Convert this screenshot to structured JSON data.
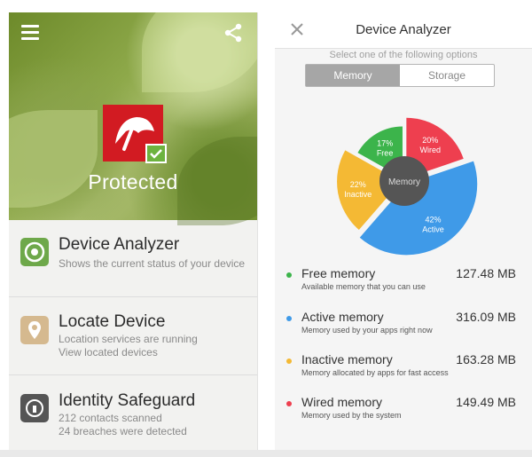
{
  "left": {
    "status": "Protected",
    "items": [
      {
        "title": "Device Analyzer",
        "lines": [
          "Shows the current status of your device"
        ]
      },
      {
        "title": "Locate Device",
        "lines": [
          "Location services are running",
          "View located devices"
        ]
      },
      {
        "title": "Identity Safeguard",
        "lines": [
          "212 contacts scanned",
          "24 breaches were detected"
        ]
      }
    ]
  },
  "icons": {
    "menu": "hamburger-menu-icon",
    "share": "share-icon",
    "logo": "avira-umbrella-logo",
    "check": "checkmark-icon",
    "analyzer": "device-analyzer-icon",
    "locate": "map-pin-icon",
    "identity": "lock-icon",
    "close": "close-icon"
  },
  "colors": {
    "brand_red": "#d21b22",
    "check_green": "#6db33f",
    "free": "#3cb44b",
    "active": "#3f9ae8",
    "inactive": "#f4b934",
    "wired": "#ee3f4f",
    "center": "#555555"
  },
  "right": {
    "title": "Device Analyzer",
    "hint": "Select one of the following options",
    "tabs": [
      {
        "label": "Memory",
        "active": true
      },
      {
        "label": "Storage",
        "active": false
      }
    ],
    "legend": [
      {
        "name": "Free memory",
        "desc": "Available memory that you can use",
        "value": "127.48 MB"
      },
      {
        "name": "Active memory",
        "desc": "Memory used by your apps right now",
        "value": "316.09 MB"
      },
      {
        "name": "Inactive memory",
        "desc": "Memory allocated by apps for fast access",
        "value": "163.28 MB"
      },
      {
        "name": "Wired memory",
        "desc": "Memory used by the system",
        "value": "149.49 MB"
      }
    ]
  },
  "chart_data": {
    "type": "pie",
    "center_label": "Memory",
    "slices": [
      {
        "pct": "17%",
        "label": "Free",
        "value": 17,
        "color": "#3cb44b"
      },
      {
        "pct": "20%",
        "label": "Wired",
        "value": 20,
        "color": "#ee3f4f"
      },
      {
        "pct": "42%",
        "label": "Active",
        "value": 42,
        "color": "#3f9ae8"
      },
      {
        "pct": "22%",
        "label": "Inactive",
        "value": 22,
        "color": "#f4b934"
      }
    ]
  }
}
